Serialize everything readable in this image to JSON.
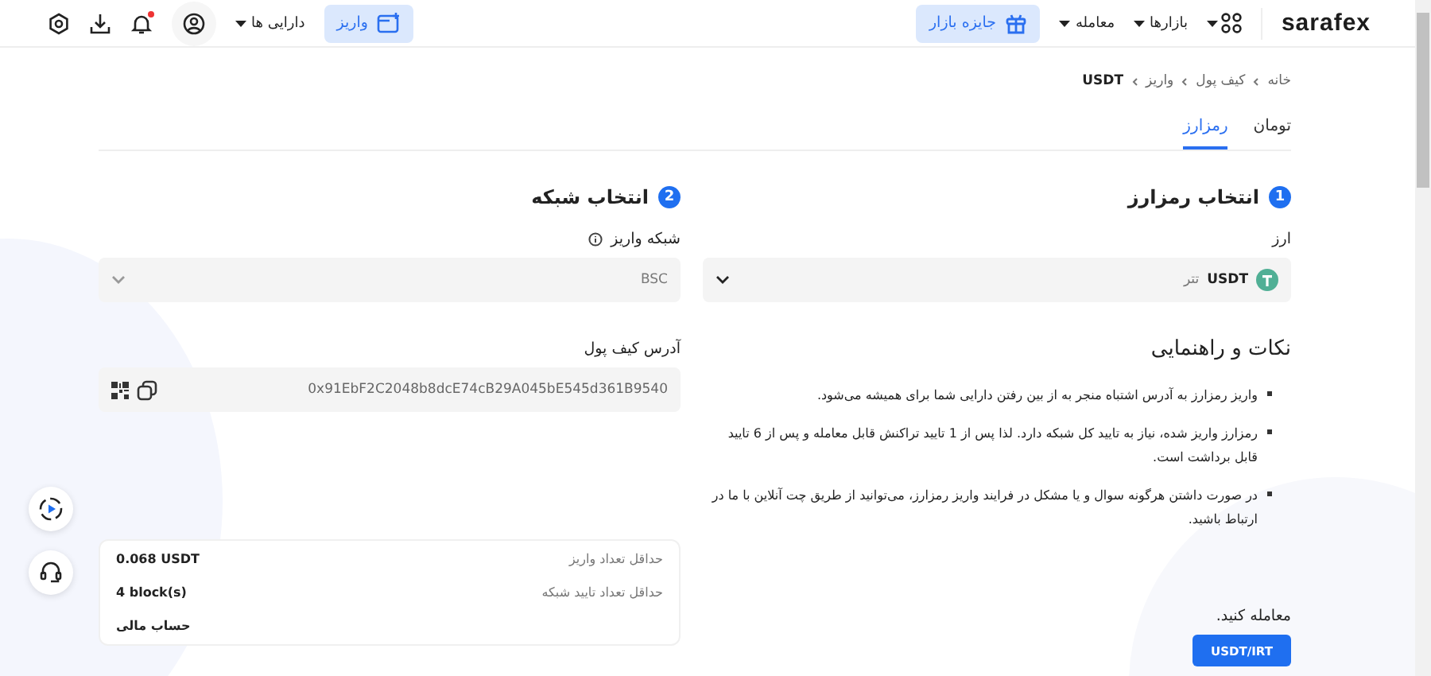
{
  "header": {
    "logo": "sarafex",
    "nav": [
      {
        "label": "بازارها"
      },
      {
        "label": "معامله"
      }
    ],
    "prize_button": "جایزه بازار",
    "deposit_button": "واریز",
    "assets_menu": "دارایی ها",
    "has_unread": true
  },
  "breadcrumb": [
    "خانه",
    "کیف پول",
    "واریز",
    "USDT"
  ],
  "tabs": [
    {
      "label": "تومان",
      "selected": false
    },
    {
      "label": "رمزارز",
      "selected": true
    }
  ],
  "step1": {
    "number": "1",
    "title": "انتخاب رمزارز",
    "field_label": "ارز",
    "currency_code": "USDT",
    "currency_name": "تتر"
  },
  "tips": {
    "title": "نکات و راهنمایی",
    "items": [
      "واریز رمزارز به آدرس اشتباه منجر به از بین رفتن دارایی شما برای همیشه می‌شود.",
      "رمزارز واریز شده، نیاز به تایید کل شبکه دارد. لذا پس از 1 تایید تراکنش قابل معامله و پس از 6 تایید قابل برداشت است.",
      "در صورت داشتن هرگونه سوال و یا مشکل در فرایند واریز رمزارز، می‌توانید از طریق چت آنلاین با ما در ارتباط باشید."
    ]
  },
  "trade": {
    "prompt": "معامله کنید.",
    "pairs": [
      "USDT/IRT"
    ]
  },
  "step2": {
    "number": "2",
    "title": "انتخاب شبکه",
    "network_label": "شبکه واریز",
    "network_value": "BSC",
    "address_label": "آدرس کیف پول",
    "address": "0x91EbF2C2048b8dcE74cB29A045bE545d361B9540"
  },
  "info_rows": [
    {
      "label": "حداقل تعداد واریز",
      "value": "0.068 USDT"
    },
    {
      "label": "حداقل تعداد تایید شبکه",
      "value": "4 block(s)"
    },
    {
      "value": "حساب مالی"
    }
  ]
}
